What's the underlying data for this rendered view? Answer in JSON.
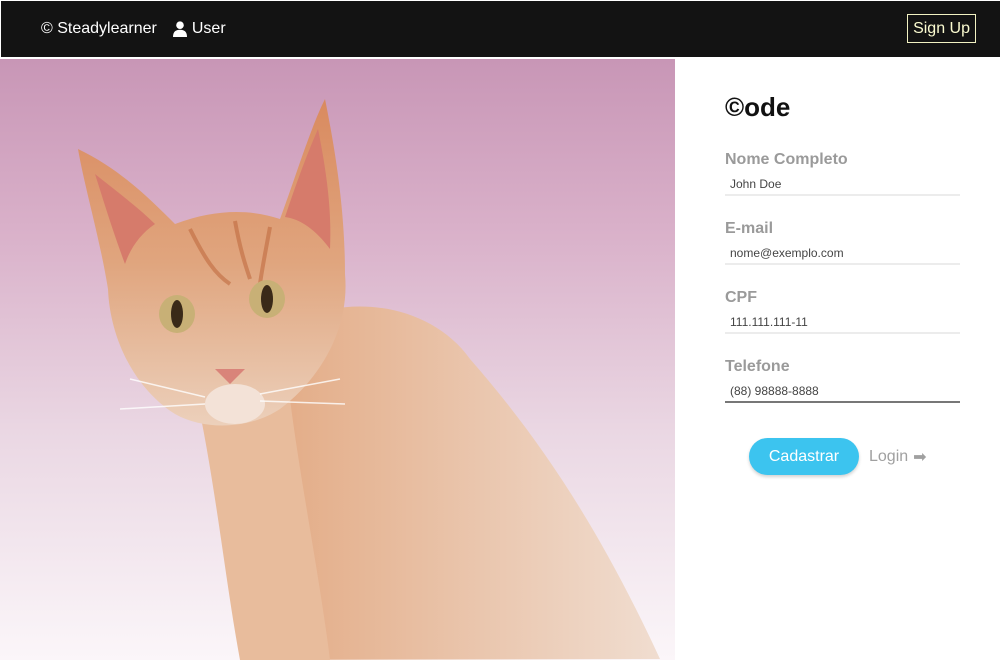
{
  "header": {
    "brand": "© Steadylearner",
    "user_label": "User",
    "signup_label": "Sign Up"
  },
  "form": {
    "logo": "©ode",
    "fields": [
      {
        "label": "Nome Completo",
        "placeholder": "John Doe"
      },
      {
        "label": "E-mail",
        "placeholder": "nome@exemplo.com"
      },
      {
        "label": "CPF",
        "placeholder": "111.111.111-11"
      },
      {
        "label": "Telefone",
        "placeholder": "(88) 98888-8888"
      }
    ],
    "submit_label": "Cadastrar",
    "login_label": "Login",
    "login_arrow": "➡"
  },
  "colors": {
    "topbar": "#131313",
    "accent": "#3cc4ef",
    "signup_border": "#f2f2c2"
  },
  "hero": {
    "subject": "cat-photo",
    "icon": "user-icon"
  }
}
